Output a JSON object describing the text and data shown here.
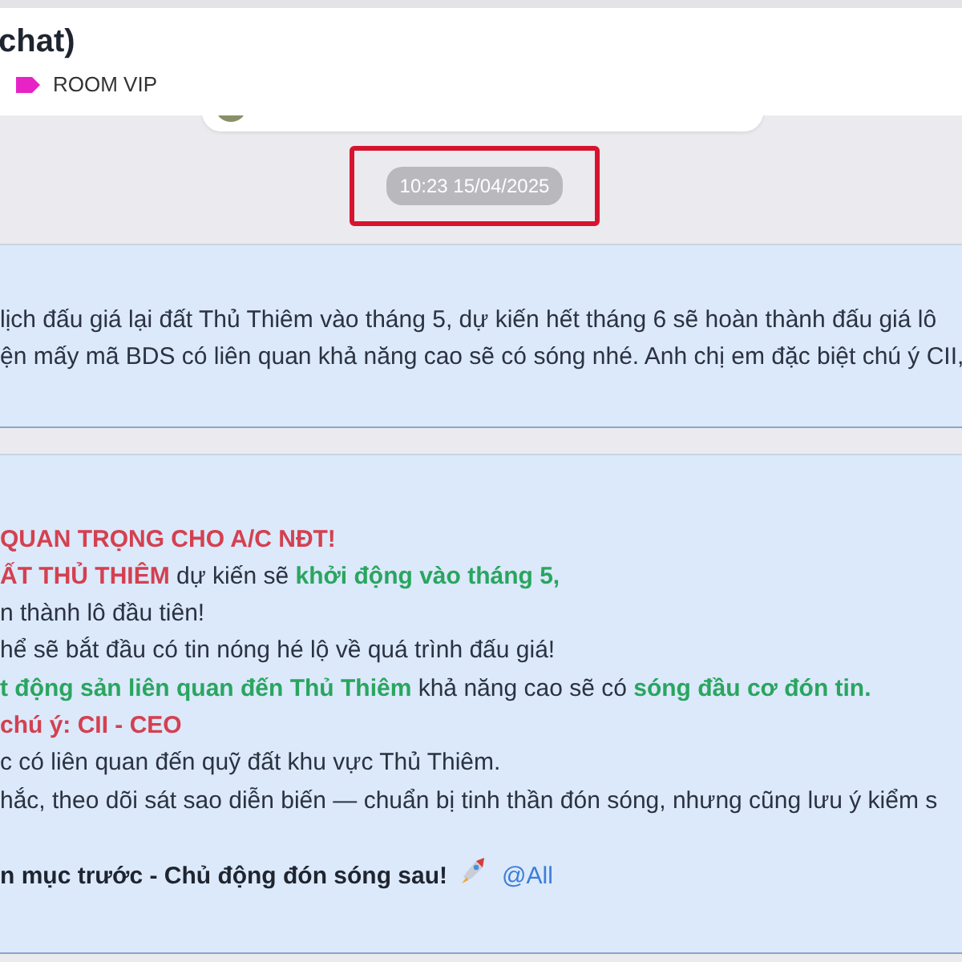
{
  "header": {
    "title": "chat)",
    "tag": {
      "label": "ROOM VIP",
      "color": "#e823c6"
    }
  },
  "timestamp": "10:23 15/04/2025",
  "messages": [
    {
      "lines": [
        {
          "parts": [
            {
              "kind": "plain",
              "text": "lịch đấu giá lại đất Thủ Thiêm vào tháng 5, dự kiến hết tháng 6 sẽ hoàn thành đấu giá lô"
            }
          ]
        },
        {
          "parts": [
            {
              "kind": "plain",
              "text": "ện mấy mã BDS có liên quan khả năng cao sẽ có sóng nhé. Anh chị em đặc biệt chú ý CII,"
            }
          ]
        }
      ]
    },
    {
      "lines": [
        {
          "parts": [
            {
              "kind": "red",
              "text": "QUAN TRỌNG CHO A/C NĐT!"
            }
          ]
        },
        {
          "parts": [
            {
              "kind": "red",
              "text": "ẤT THỦ THIÊM"
            },
            {
              "kind": "plain",
              "text": " dự kiến sẽ "
            },
            {
              "kind": "green",
              "text": "khởi động vào tháng 5,"
            }
          ]
        },
        {
          "parts": [
            {
              "kind": "plain",
              "text": "n thành lô đầu tiên!"
            }
          ]
        },
        {
          "parts": [
            {
              "kind": "plain",
              "text": "hể sẽ bắt đầu có tin nóng hé lộ về quá trình đấu giá!"
            }
          ]
        },
        {
          "parts": [
            {
              "kind": "green",
              "text": "t động sản liên quan đến Thủ Thiêm"
            },
            {
              "kind": "plain",
              "text": " khả năng cao sẽ có "
            },
            {
              "kind": "green",
              "text": "sóng đầu cơ đón tin."
            }
          ]
        },
        {
          "parts": [
            {
              "kind": "red",
              "text": "chú ý: CII - CEO"
            }
          ]
        },
        {
          "parts": [
            {
              "kind": "plain",
              "text": "c có liên quan đến quỹ đất khu vực Thủ Thiêm."
            }
          ]
        },
        {
          "parts": [
            {
              "kind": "plain",
              "text": "hắc, theo dõi sát sao diễn biến — chuẩn bị tinh thần đón sóng, nhưng cũng lưu ý kiểm s"
            }
          ]
        },
        {
          "spaced": true,
          "parts": [
            {
              "kind": "bold",
              "text": "n mục trước - Chủ động đón sóng sau!"
            },
            {
              "kind": "rocket"
            },
            {
              "kind": "mention",
              "text": "@All"
            }
          ]
        }
      ]
    }
  ]
}
